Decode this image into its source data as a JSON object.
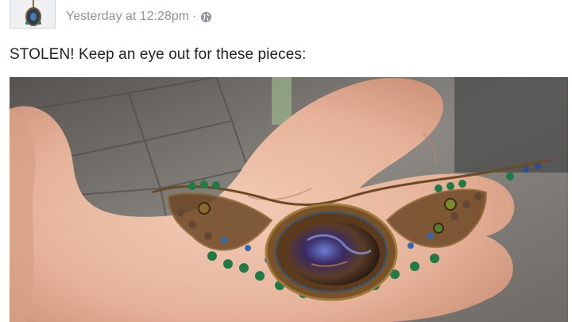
{
  "post": {
    "timestamp": "Yesterday at 12:28pm",
    "separator": "·",
    "audience_icon": "globe-icon",
    "status_text": "STOLEN! Keep an eye out for these pieces:",
    "photo_subject": "hand-holding-beaded-necklace"
  },
  "colors": {
    "meta_text": "#90949c",
    "body_text": "#1d2129",
    "border": "#d3d6db"
  }
}
